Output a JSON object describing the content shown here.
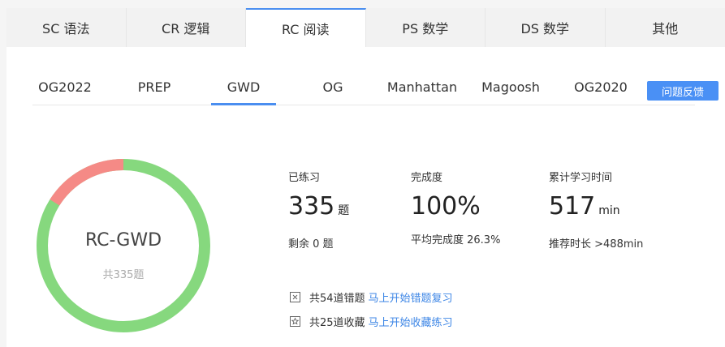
{
  "top_tabs": [
    {
      "label": "SC 语法"
    },
    {
      "label": "CR 逻辑"
    },
    {
      "label": "RC 阅读"
    },
    {
      "label": "PS 数学"
    },
    {
      "label": "DS 数学"
    },
    {
      "label": "其他"
    }
  ],
  "active_top_tab": "RC 阅读",
  "sub_tabs": [
    {
      "label": "OG2022"
    },
    {
      "label": "PREP"
    },
    {
      "label": "GWD"
    },
    {
      "label": "OG"
    },
    {
      "label": "Manhattan"
    },
    {
      "label": "Magoosh"
    },
    {
      "label": "OG2020"
    }
  ],
  "active_sub_tab": "GWD",
  "feedback_label": "问题反馈",
  "ring": {
    "title": "RC-GWD",
    "subtitle": "共335题",
    "correct_fraction": 0.839,
    "colors": {
      "correct": "#86d87e",
      "wrong": "#f58a86"
    }
  },
  "stats": {
    "practiced": {
      "label": "已练习",
      "value": "335",
      "unit": "题",
      "foot": "剩余 0 题"
    },
    "completion": {
      "label": "完成度",
      "value": "100%",
      "foot": "平均完成度 26.3%"
    },
    "time": {
      "label": "累计学习时间",
      "value": "517",
      "unit": "min",
      "foot": "推荐时长 >488min"
    }
  },
  "actions": {
    "wrong": {
      "text": "共54道错题",
      "link": "马上开始错题复习"
    },
    "fav": {
      "text": "共25道收藏",
      "link": "马上开始收藏练习"
    }
  },
  "colors": {
    "accent": "#4a8ef0",
    "link": "#3d86e6"
  }
}
